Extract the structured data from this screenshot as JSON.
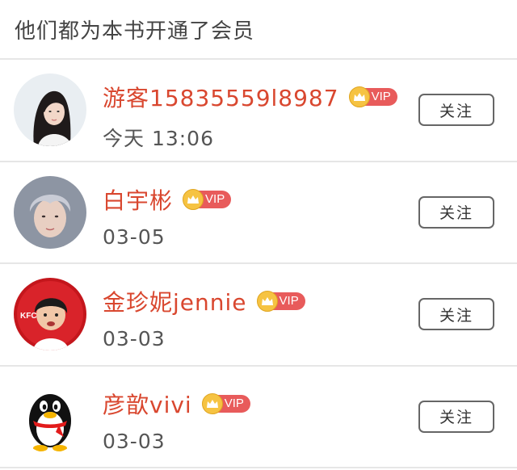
{
  "header": {
    "title": "他们都为本书开通了会员"
  },
  "members": [
    {
      "name": "游客15835559l8987",
      "vip": "VIP",
      "date": "今天 13:06",
      "follow_label": "关注",
      "avatar": "avatar-girl-long-hair"
    },
    {
      "name": "白宇彬",
      "vip": "VIP",
      "date": "03-05",
      "follow_label": "关注",
      "avatar": "avatar-boy-silver-hair"
    },
    {
      "name": "金珍妮jennie",
      "vip": "VIP",
      "date": "03-03",
      "follow_label": "关注",
      "avatar": "avatar-kfc-kid"
    },
    {
      "name": "彦歆vivi",
      "vip": "VIP",
      "date": "03-03",
      "follow_label": "关注",
      "avatar": "avatar-qq-penguin"
    }
  ],
  "colors": {
    "name": "#d9472f",
    "vip_badge": "#e85b5b",
    "crown": "#f6c342",
    "divider": "#e6e6e6"
  }
}
